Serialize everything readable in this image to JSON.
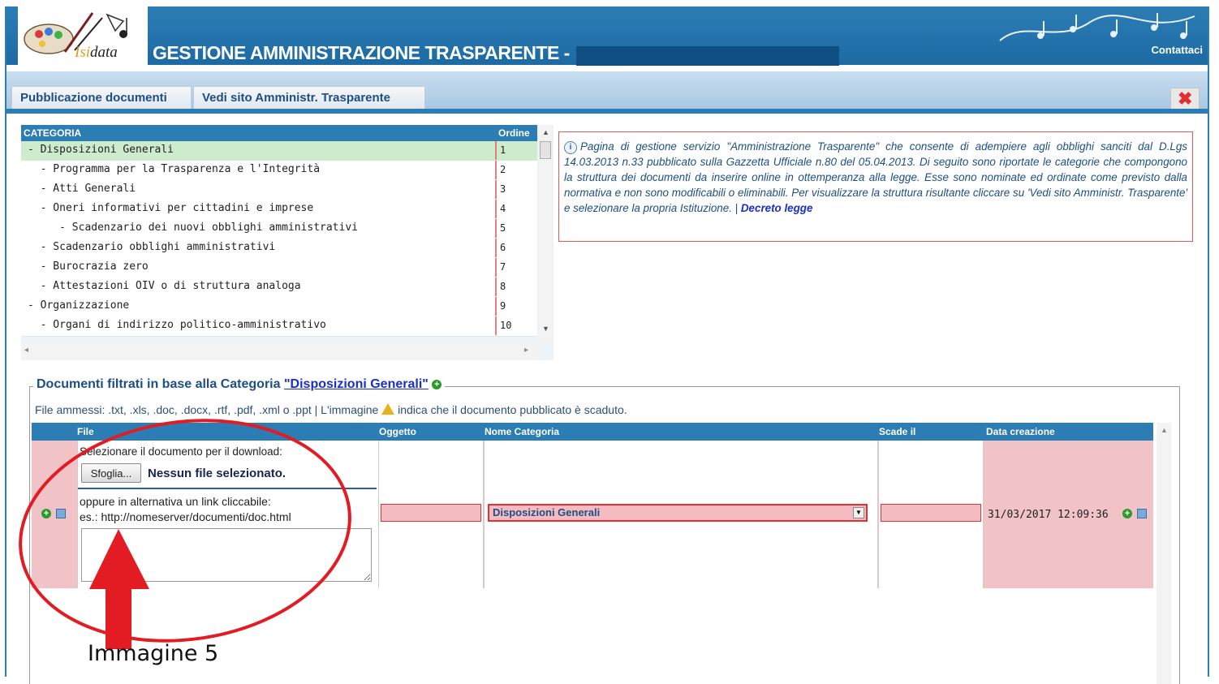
{
  "header": {
    "logo_prefix": "Isi",
    "logo_mid": "data",
    "title": "GESTIONE AMMINISTRAZIONE TRASPARENTE -",
    "contact_label": "Contattaci"
  },
  "tabs": [
    {
      "label": "Pubblicazione documenti"
    },
    {
      "label": "Vedi sito Amministr. Trasparente"
    }
  ],
  "categories": {
    "header_name": "CATEGORIA",
    "header_order": "Ordine",
    "rows": [
      {
        "name": "- Disposizioni Generali",
        "order": "1",
        "selected": true
      },
      {
        "name": "  - Programma per la Trasparenza e l'Integrità",
        "order": "2"
      },
      {
        "name": "  - Atti Generali",
        "order": "3"
      },
      {
        "name": "  - Oneri informativi per cittadini e imprese",
        "order": "4"
      },
      {
        "name": "     - Scadenzario dei nuovi obblighi amministrativi",
        "order": "5"
      },
      {
        "name": "  - Scadenzario obblighi amministrativi",
        "order": "6"
      },
      {
        "name": "  - Burocrazia zero",
        "order": "7"
      },
      {
        "name": "  - Attestazioni OIV o di struttura analoga",
        "order": "8"
      },
      {
        "name": "- Organizzazione",
        "order": "9"
      },
      {
        "name": "  - Organi di indirizzo politico-amministrativo",
        "order": "10"
      }
    ]
  },
  "info": {
    "text": "Pagina di gestione servizio \"Amministrazione Trasparente\" che consente di adempiere agli obblighi sanciti dal D.Lgs 14.03.2013 n.33 pubblicato sulla Gazzetta Ufficiale n.80 del 05.04.2013. Di seguito sono riportate le categorie che compongono la struttura dei documenti da inserire online in ottemperanza alla legge. Esse sono nominate ed ordinate come previsto dalla normativa e non sono modificabili o eliminabili. Per visualizzare la struttura risultante cliccare su 'Vedi sito Amministr. Trasparente' e selezionare la propria Istituzione. |",
    "link": "Decreto legge"
  },
  "documents": {
    "legend_prefix": "Documenti filtrati in base alla Categoria",
    "legend_category": "\"Disposizioni Generali\"",
    "file_types_text": "File ammessi: .txt, .xls, .doc, .docx, .rtf, .pdf, .xml o .ppt  |  L'immagine",
    "file_types_suffix": "indica che il documento pubblicato è scaduto.",
    "columns": {
      "file": "File",
      "oggetto": "Oggetto",
      "nome_categoria": "Nome Categoria",
      "scade": "Scade  il",
      "data_creazione": "Data  creazione"
    },
    "row": {
      "select_label": "Selezionare il documento per il download:",
      "browse_label": "Sfoglia...",
      "no_file": "Nessun file selezionato.",
      "alt_line1": "oppure in alternativa un link cliccabile:",
      "alt_line2": "es.: http://nomeserver/documenti/doc.html",
      "category_value": "Disposizioni Generali",
      "created": "31/03/2017 12:09:36"
    }
  },
  "annotation": {
    "label": "Immagine 5"
  },
  "colors": {
    "header_blue": "#2d7db5",
    "selected_row": "#cdeccd",
    "pending_row": "#f1c2c6",
    "annotation_red": "#e31b23"
  }
}
